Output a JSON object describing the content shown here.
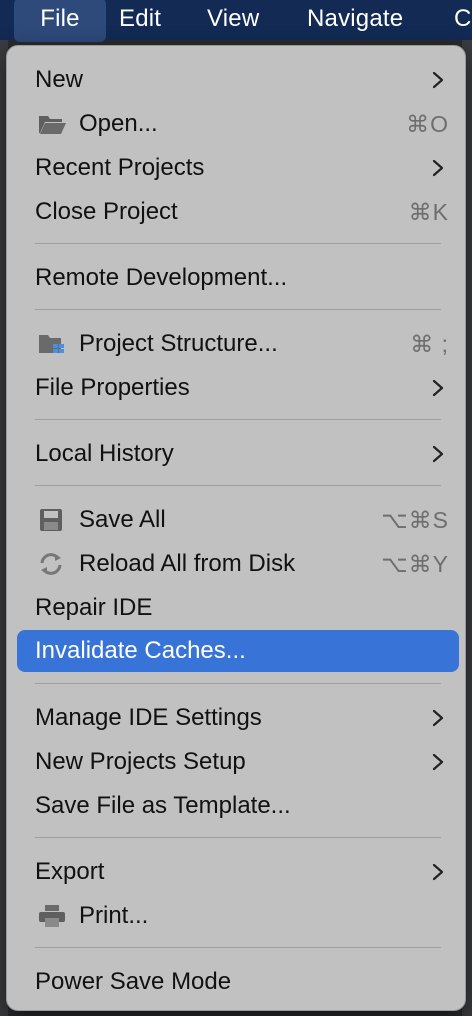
{
  "menubar": {
    "items": [
      "File",
      "Edit",
      "View",
      "Navigate",
      "C"
    ]
  },
  "menu": {
    "items": [
      {
        "label": "New",
        "submenu": true
      },
      {
        "label": "Open...",
        "shortcut": "⌘O",
        "icon": "folder-icon"
      },
      {
        "label": "Recent Projects",
        "submenu": true
      },
      {
        "label": "Close Project",
        "shortcut": "⌘K"
      },
      {
        "label": "Remote Development..."
      },
      {
        "label": "Project Structure...",
        "shortcut": "⌘ ;",
        "icon": "project-structure-icon"
      },
      {
        "label": "File Properties",
        "submenu": true
      },
      {
        "label": "Local History",
        "submenu": true
      },
      {
        "label": "Save All",
        "shortcut": "⌥⌘S",
        "icon": "save-icon"
      },
      {
        "label": "Reload All from Disk",
        "shortcut": "⌥⌘Y",
        "icon": "reload-icon"
      },
      {
        "label": "Repair IDE"
      },
      {
        "label": "Invalidate Caches...",
        "highlighted": true
      },
      {
        "label": "Manage IDE Settings",
        "submenu": true
      },
      {
        "label": "New Projects Setup",
        "submenu": true
      },
      {
        "label": "Save File as Template..."
      },
      {
        "label": "Export",
        "submenu": true
      },
      {
        "label": "Print...",
        "icon": "printer-icon"
      },
      {
        "label": "Power Save Mode"
      }
    ]
  },
  "colors": {
    "menubar_bg": "#122a54",
    "menu_bg": "#c1c1c1",
    "highlight": "#3874d8",
    "shortcut_text": "#6e6e6e"
  }
}
